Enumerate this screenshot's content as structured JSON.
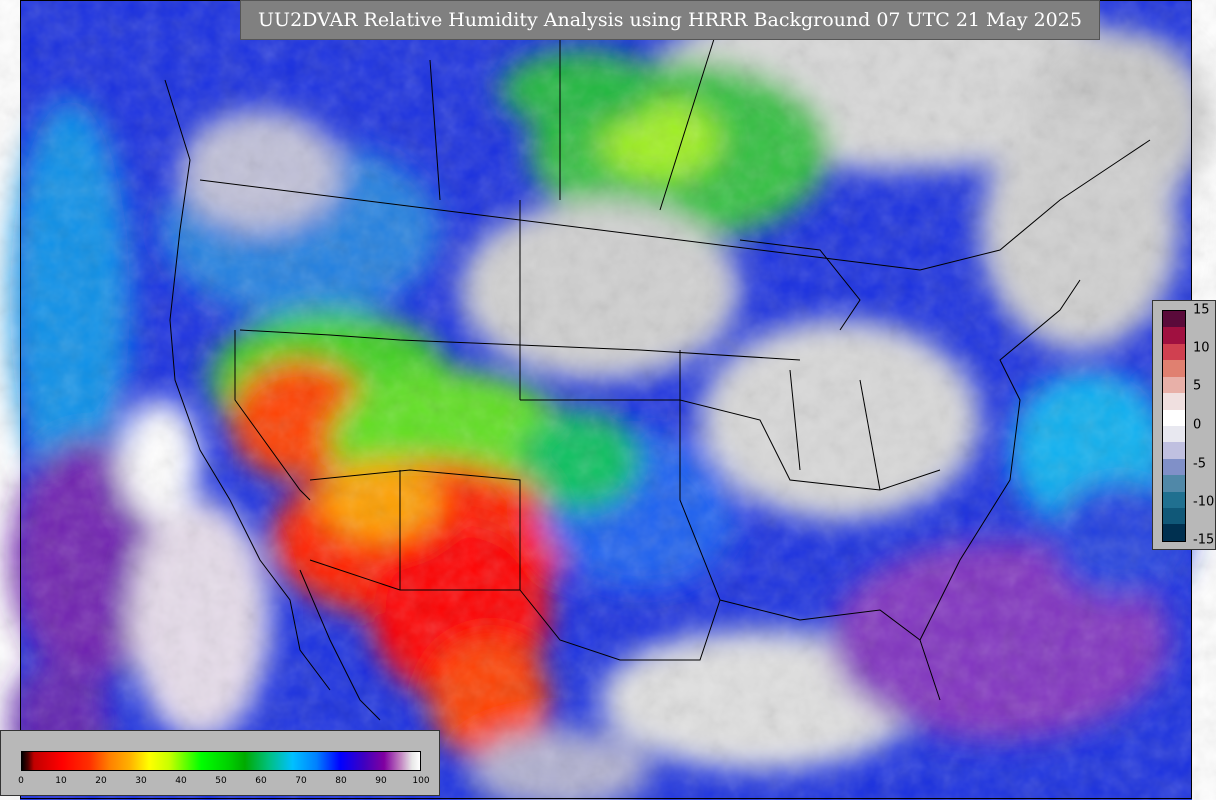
{
  "title": "UU2DVAR Relative Humidity Analysis using HRRR Background 07 UTC 21 May 2025",
  "rh_legend": {
    "ticks": [
      "0",
      "10",
      "20",
      "30",
      "40",
      "50",
      "60",
      "70",
      "80",
      "90",
      "100"
    ]
  },
  "diff_legend": {
    "ticks": [
      "15",
      "10",
      "5",
      "0",
      "-5",
      "-10",
      "-15"
    ],
    "colors": [
      "#5a0a3a",
      "#a01040",
      "#d04050",
      "#e08070",
      "#e8b0a8",
      "#f0e0e0",
      "#ffffff",
      "#e8e8f0",
      "#c0c0e0",
      "#8090c8",
      "#5088a8",
      "#207090",
      "#105878",
      "#003050"
    ]
  }
}
